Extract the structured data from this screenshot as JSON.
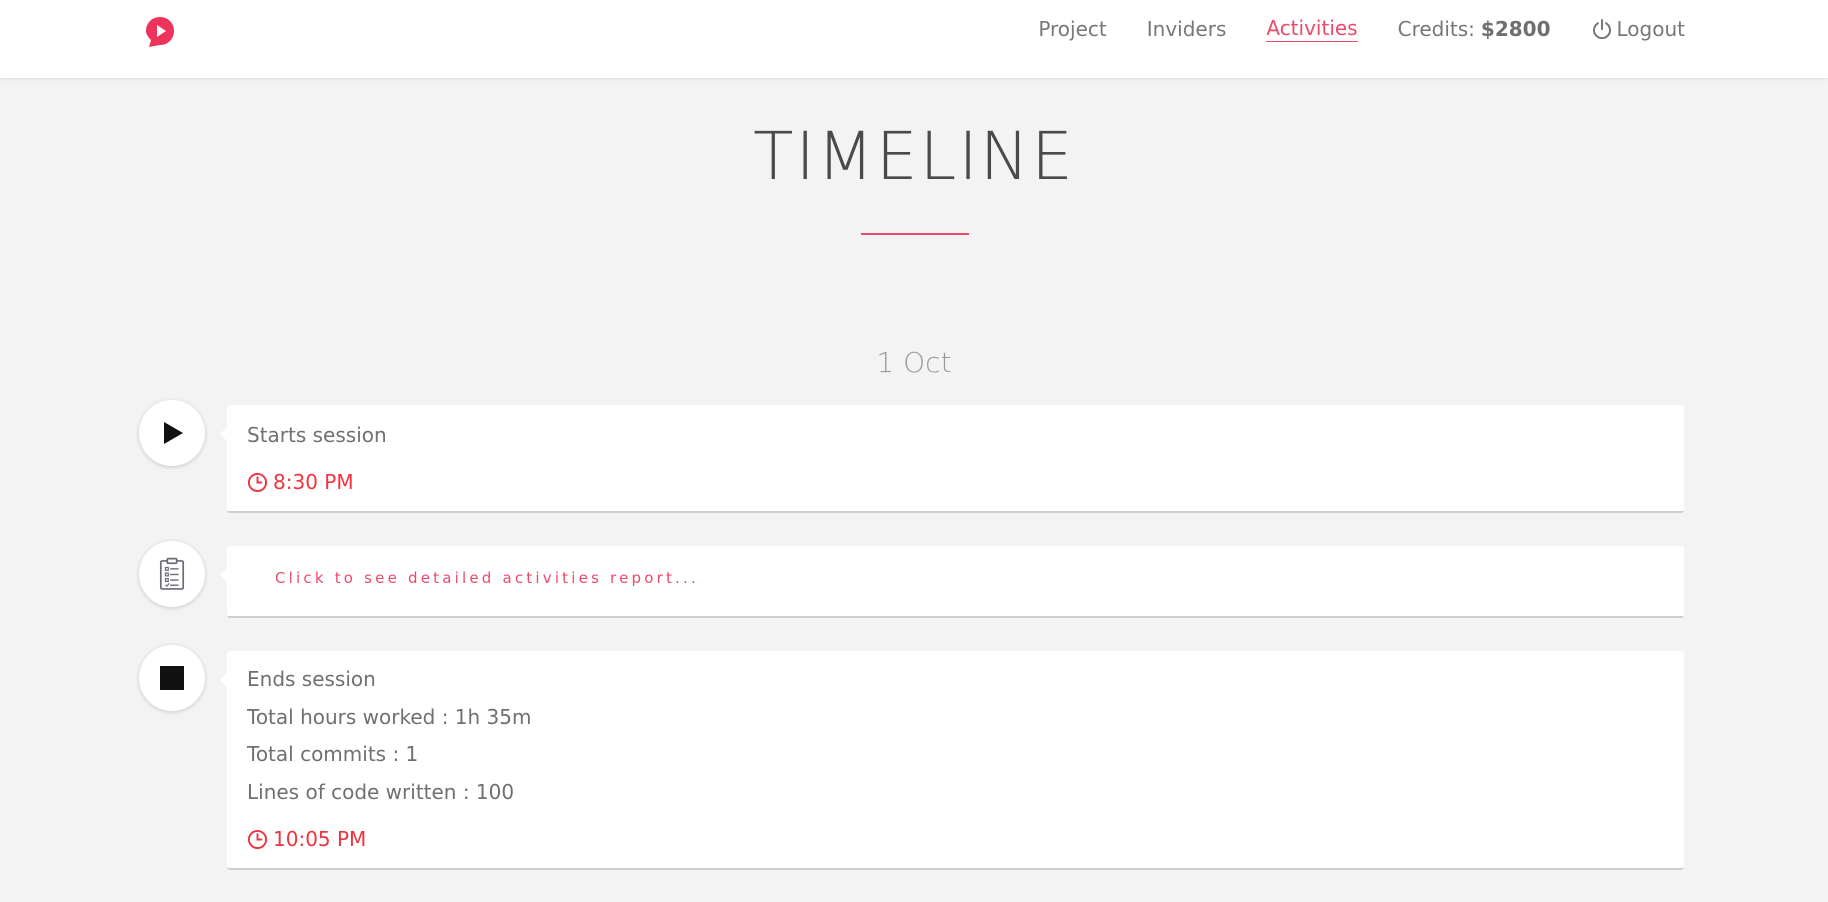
{
  "colors": {
    "accent": "#ec4a6b",
    "time": "#f0333f",
    "background": "#f3f3f3",
    "card": "#ffffff"
  },
  "navbar": {
    "logo_icon": "play-bubble-logo",
    "items": [
      {
        "label": "Project"
      },
      {
        "label": "Inviders"
      },
      {
        "label": "Activities",
        "active": true
      }
    ],
    "credits_label": "Credits:",
    "credits_value": "$2800",
    "logout_label": "Logout",
    "logout_icon": "power-icon"
  },
  "page": {
    "title": "TIMELINE"
  },
  "timeline": {
    "date": "1 Oct",
    "entries": [
      {
        "icon": "play-icon",
        "title": "Starts session",
        "time": "8:30 PM"
      },
      {
        "icon": "clipboard-icon",
        "link": "Click to see detailed activities report..."
      },
      {
        "icon": "stop-icon",
        "title": "Ends session",
        "lines": [
          "Total hours worked : 1h 35m",
          "Total commits : 1",
          "Lines of code written : 100"
        ],
        "time": "10:05 PM"
      }
    ]
  }
}
